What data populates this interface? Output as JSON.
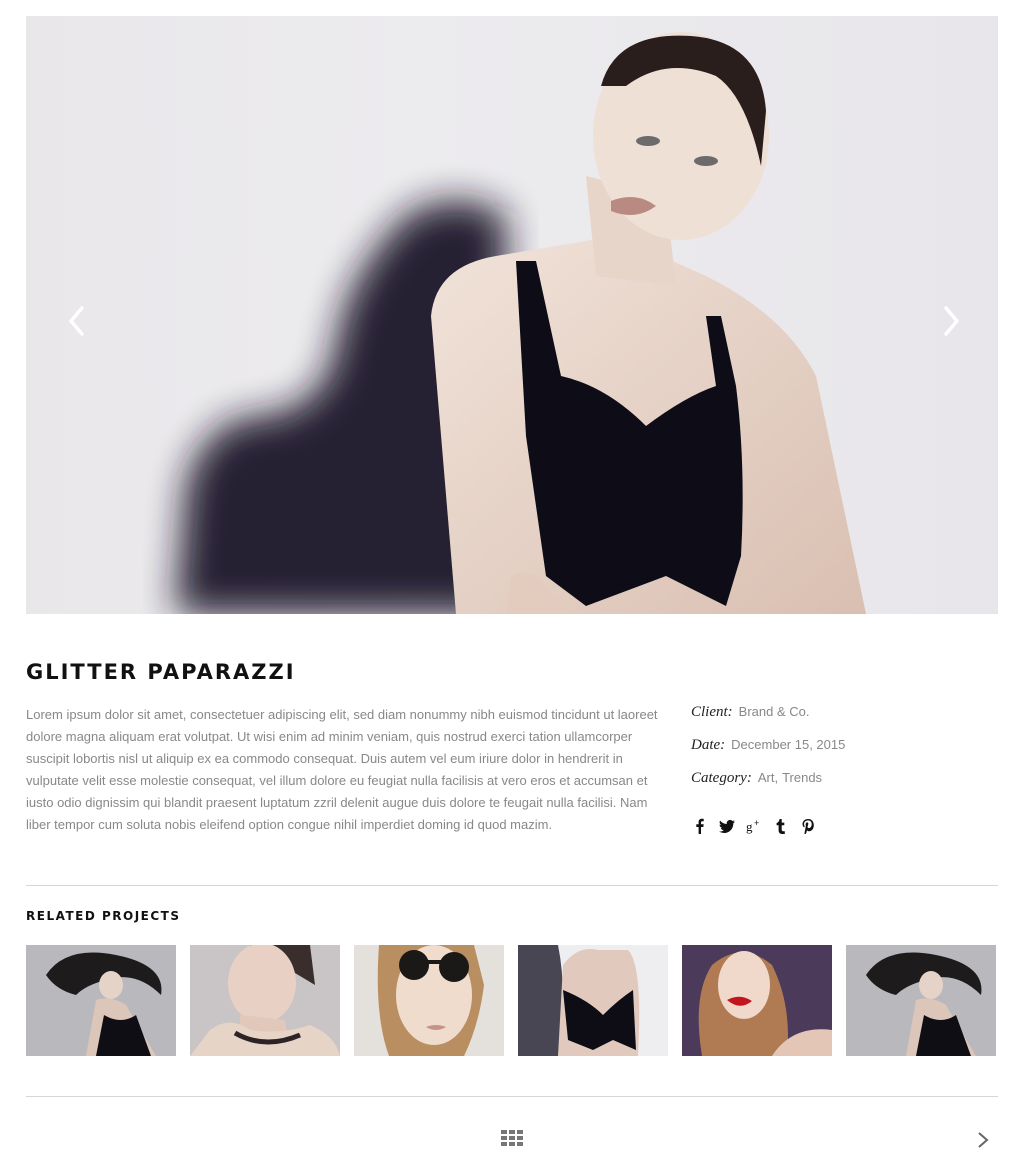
{
  "hero": {
    "image_alt": "Fashion model in black crop top against light wall",
    "prev_icon": "chevron-left-icon",
    "next_icon": "chevron-right-icon"
  },
  "project": {
    "title": "GLITTER PAPARAZZI",
    "description": "Lorem ipsum dolor sit amet, consectetuer adipiscing elit, sed diam nonummy nibh euismod tincidunt ut laoreet dolore magna aliquam erat volutpat. Ut wisi enim ad minim veniam, quis nostrud exerci tation ullamcorper suscipit lobortis nisl ut aliquip ex ea commodo consequat. Duis autem vel eum iriure dolor in hendrerit in vulputate velit esse molestie consequat, vel illum dolore eu feugiat nulla facilisis at vero eros et accumsan et iusto odio dignissim qui blandit praesent luptatum zzril delenit augue duis dolore te feugait nulla facilisi. Nam liber tempor cum soluta nobis eleifend option congue nihil imperdiet doming id quod mazim."
  },
  "meta": {
    "client_label": "Client:",
    "client_value": "Brand & Co.",
    "date_label": "Date:",
    "date_value": "December 15, 2015",
    "category_label": "Category:",
    "category_1": "Art",
    "category_sep": ",",
    "category_2": "Trends"
  },
  "social": [
    "facebook-icon",
    "twitter-icon",
    "google-plus-icon",
    "tumblr-icon",
    "pinterest-icon"
  ],
  "related": {
    "title": "RELATED PROJECTS",
    "thumb_count": 6
  },
  "nav": {
    "grid_icon": "grid-icon",
    "next_icon": "chevron-right-icon"
  },
  "colors": {
    "text_dark": "#111111",
    "text_muted": "#888888",
    "divider": "#d6d6d6",
    "background": "#ffffff"
  }
}
